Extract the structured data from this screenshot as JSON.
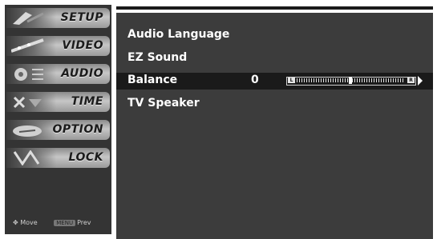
{
  "sidebar": {
    "items": [
      {
        "label": "SETUP",
        "icon": "setup-picture-icon"
      },
      {
        "label": "VIDEO",
        "icon": "video-picture-icon"
      },
      {
        "label": "AUDIO",
        "icon": "audio-picture-icon"
      },
      {
        "label": "TIME",
        "icon": "time-picture-icon"
      },
      {
        "label": "OPTION",
        "icon": "option-picture-icon"
      },
      {
        "label": "LOCK",
        "icon": "lock-picture-icon"
      }
    ],
    "legend": {
      "move_label": "Move",
      "menu_key": "MENU",
      "prev_label": "Prev"
    }
  },
  "menu": {
    "items": [
      {
        "label": "Audio Language"
      },
      {
        "label": "EZ Sound"
      },
      {
        "label": "Balance",
        "value": "0",
        "selected": true
      },
      {
        "label": "TV Speaker"
      }
    ]
  },
  "balance": {
    "left_label": "L",
    "right_label": "R",
    "value": 0,
    "min": -50,
    "max": 50
  }
}
